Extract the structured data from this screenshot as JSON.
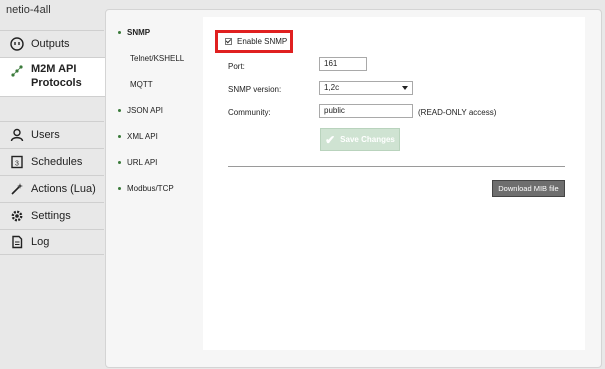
{
  "brand": "netio-4all",
  "nav": {
    "outputs": "Outputs",
    "m2m_line1": "M2M API",
    "m2m_line2": "Protocols",
    "users": "Users",
    "schedules": "Schedules",
    "actions": "Actions (Lua)",
    "settings": "Settings",
    "log": "Log"
  },
  "subnav": {
    "snmp": "SNMP",
    "telnet": "Telnet/KSHELL",
    "mqtt": "MQTT",
    "json": "JSON API",
    "xml": "XML API",
    "url": "URL API",
    "modbus": "Modbus/TCP"
  },
  "form": {
    "enable_label": "Enable SNMP",
    "enable_checked": true,
    "port_label": "Port:",
    "port_value": "161",
    "version_label": "SNMP version:",
    "version_value": "1,2c",
    "community_label": "Community:",
    "community_value": "public",
    "community_note": "(READ-ONLY access)",
    "save_label": "Save Changes",
    "download_label": "Download MIB file"
  },
  "colors": {
    "highlight": "#e02020",
    "save_disabled": "#cfe3d2",
    "accent_green": "#3a7a3a"
  }
}
